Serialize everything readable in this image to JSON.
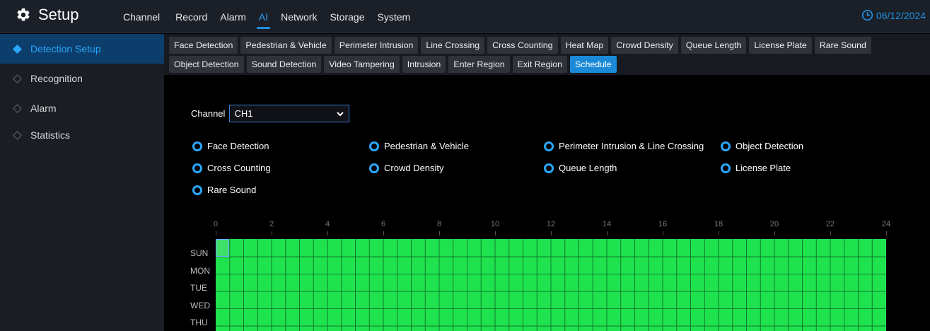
{
  "header": {
    "title": "Setup",
    "menu": [
      "Channel",
      "Record",
      "Alarm",
      "AI",
      "Network",
      "Storage",
      "System"
    ],
    "active_menu": "AI",
    "date": "06/12/2024"
  },
  "sidebar": {
    "items": [
      {
        "label": "Detection Setup",
        "active": true
      },
      {
        "label": "Recognition",
        "active": false
      },
      {
        "label": "Alarm",
        "active": false
      },
      {
        "label": "Statistics",
        "active": false
      }
    ]
  },
  "tabs": {
    "row1": [
      "Face Detection",
      "Pedestrian & Vehicle",
      "Perimeter Intrusion",
      "Line Crossing",
      "Cross Counting",
      "Heat Map",
      "Crowd Density",
      "Queue Length",
      "License Plate",
      "Rare Sound"
    ],
    "row2": [
      "Object Detection",
      "Sound Detection",
      "Video Tampering",
      "Intrusion",
      "Enter Region",
      "Exit Region",
      "Schedule"
    ],
    "active": "Schedule"
  },
  "channel": {
    "label": "Channel",
    "value": "CH1"
  },
  "options": [
    {
      "label": "Face Detection",
      "selected": true
    },
    {
      "label": "Pedestrian & Vehicle",
      "selected": false
    },
    {
      "label": "Perimeter Intrusion & Line Crossing",
      "selected": false
    },
    {
      "label": "Object Detection",
      "selected": false
    },
    {
      "label": "Cross Counting",
      "selected": false
    },
    {
      "label": "Crowd Density",
      "selected": false
    },
    {
      "label": "Queue Length",
      "selected": false
    },
    {
      "label": "License Plate",
      "selected": false
    },
    {
      "label": "Rare Sound",
      "selected": false
    }
  ],
  "schedule": {
    "hours": [
      "0",
      "2",
      "4",
      "6",
      "8",
      "10",
      "12",
      "14",
      "16",
      "18",
      "20",
      "22",
      "24"
    ],
    "days": [
      "SUN",
      "MON",
      "TUE",
      "WED",
      "THU"
    ],
    "fill_color": "#1fe24f"
  },
  "colors": {
    "accent": "#1d8fe0",
    "highlight": "#2aa8ff"
  }
}
